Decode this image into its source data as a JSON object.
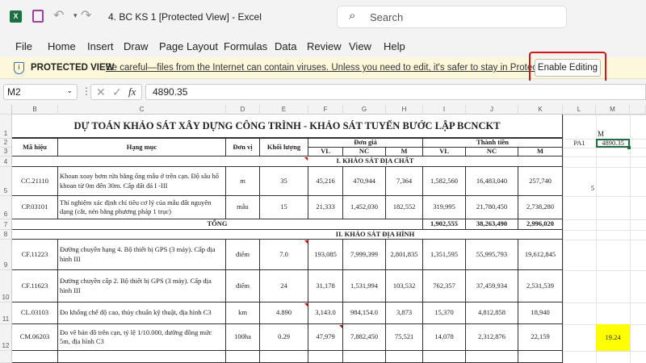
{
  "app": {
    "title": "4. BC KS  1  [Protected View]  -  Excel",
    "search_placeholder": "Search",
    "brand_color": "#1d6f42"
  },
  "menu": [
    "File",
    "Home",
    "Insert",
    "Draw",
    "Page Layout",
    "Formulas",
    "Data",
    "Review",
    "View",
    "Help"
  ],
  "protected_view": {
    "label": "PROTECTED VIEW",
    "message": "Be careful—files from the Internet can contain viruses. Unless you need to edit, it's safer to stay in Protected View.",
    "button": "Enable Editing",
    "highlight_color": "#d0161d"
  },
  "formula_bar": {
    "name_box": "M2",
    "fx": "fx",
    "value": "4890.35"
  },
  "columns": [
    "B",
    "C",
    "D",
    "E",
    "F",
    "G",
    "H",
    "I",
    "J",
    "K",
    "L",
    "M"
  ],
  "rows": [
    "1",
    "2",
    "3",
    "4",
    "5",
    "6",
    "7",
    "8",
    "9",
    "10",
    "11",
    "12"
  ],
  "sheet": {
    "title": "DỰ TOÁN KHẢO SÁT XÂY DỰNG CÔNG TRÌNH - KHẢO SÁT TUYẾN BƯỚC LẬP BCNCKT",
    "headers": {
      "code": "Mã hiệu",
      "item": "Hạng mục",
      "unit": "Đơn vị",
      "qty": "Khối lượng",
      "unit_price": "Đơn giá",
      "amount": "Thành tiền",
      "vl": "VL",
      "nc": "NC",
      "m": "M"
    },
    "section1": "I. KHẢO SÁT ĐỊA CHẤT",
    "section2": "II. KHẢO SÁT ĐỊA HÌNH",
    "total_label": "TỔNG",
    "total": [
      "1,902,555",
      "38,263,490",
      "2,996,020"
    ],
    "items1": [
      [
        "CC.21110",
        "Khoan xoay bơm rửa bằng ống mẫu ở trên cạn.  Độ sâu hố khoan từ 0m đến 30m. Cấp đất đá I -III",
        "m",
        "35",
        "45,216",
        "470,944",
        "7,364",
        "1,582,560",
        "16,483,040",
        "257,740"
      ],
      [
        "CP.03101",
        "Thí nghiệm xác định chỉ tiêu cơ lý của mẫu đất nguyên dạng (cắt, nén bằng phương pháp 1 trục)",
        "mẫu",
        "15",
        "21,333",
        "1,452,030",
        "182,552",
        "319,995",
        "21,780,450",
        "2,738,280"
      ]
    ],
    "items2": [
      [
        "CF.11223",
        "Đường chuyền hạng 4. Bộ thiết bị GPS (3 máy). Cấp địa hình III",
        "điểm",
        "7.0",
        "193,085",
        "7,999,399",
        "2,801,835",
        "1,351,595",
        "55,995,793",
        "19,612,845"
      ],
      [
        "CF.11623",
        "Đường chuyền cấp 2. Bộ thiết bị GPS (3 máy). Cấp địa hình III",
        "điểm",
        "24",
        "31,178",
        "1,531,994",
        "103,532",
        "762,357",
        "37,459,934",
        "2,531,539"
      ],
      [
        "CL.03103",
        "Đo khống chế độ cao, thủy chuẩn kỹ thuật, địa hình C3",
        "km",
        "4.890",
        "3,143.0",
        "984,154.0",
        "3,873",
        "15,370",
        "4,812,858",
        "18,940"
      ],
      [
        "CM.06203",
        "Đo vẽ bản đồ trên cạn, tỷ lệ 1/10.000, đường đồng mức 5m, địa hình C3",
        "100ha",
        "0.29",
        "47,979",
        "7,882,450",
        "75,521",
        "14,078",
        "2,312,876",
        "22,159"
      ]
    ],
    "side": {
      "m1": "M",
      "l2": "PA1",
      "m2": "4890.35",
      "l5": "5",
      "m12": "19.24",
      "highlight_color": "#ffff00"
    }
  }
}
